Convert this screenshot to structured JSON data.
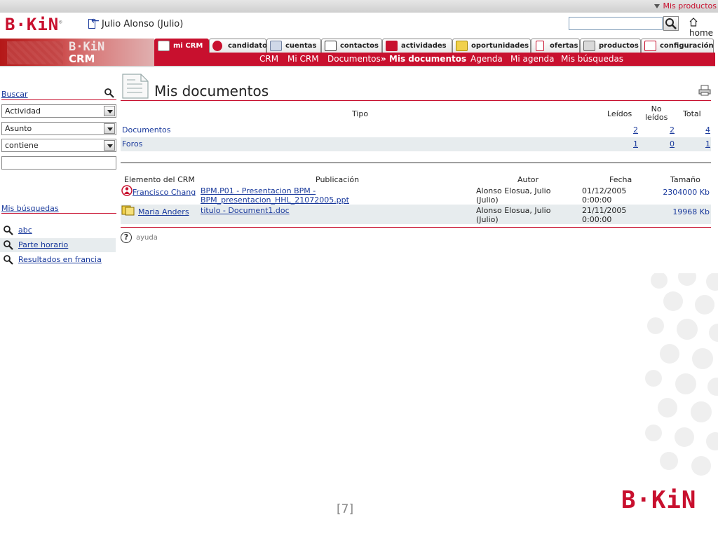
{
  "top": {
    "mis_productos": "Mis productos"
  },
  "header": {
    "logo": "B·KiN",
    "user": "Julio Alonso (Julio)",
    "search_placeholder": "",
    "home": "home"
  },
  "banner": {
    "brand": "B·KiN",
    "product": "CRM"
  },
  "tabs": [
    {
      "label": "mi CRM",
      "active": true,
      "icon": "monitor-icon"
    },
    {
      "label": "candidatos",
      "active": false,
      "icon": "person-icon"
    },
    {
      "label": "cuentas",
      "active": false,
      "icon": "folder-icon"
    },
    {
      "label": "contactos",
      "active": false,
      "icon": "contact-card-icon"
    },
    {
      "label": "actividades",
      "active": false,
      "icon": "calendar-icon"
    },
    {
      "label": "oportunidades",
      "active": false,
      "icon": "cards-icon"
    },
    {
      "label": "ofertas",
      "active": false,
      "icon": "alert-icon"
    },
    {
      "label": "productos",
      "active": false,
      "icon": "box-icon"
    },
    {
      "label": "configuración",
      "active": false,
      "icon": "wrench-icon"
    }
  ],
  "subnav": [
    {
      "label": "CRM",
      "current": false
    },
    {
      "label": "Mi CRM",
      "current": false
    },
    {
      "label": "Documentos",
      "current": false
    },
    {
      "label": "» Mis documentos",
      "current": true
    },
    {
      "label": "Agenda",
      "current": false
    },
    {
      "label": "Mi agenda",
      "current": false
    },
    {
      "label": "Mis búsquedas",
      "current": false
    }
  ],
  "left": {
    "buscar": "Buscar",
    "selects": [
      "Actividad",
      "Asunto",
      "contiene"
    ],
    "text_value": "",
    "mis_busquedas": "Mis búsquedas",
    "searches": [
      "abc",
      "Parte horario",
      "Resultados en francia"
    ]
  },
  "main": {
    "title": "Mis documentos",
    "summary": {
      "headers": {
        "tipo": "Tipo",
        "leidos": "Leídos",
        "no_leidos_1": "No",
        "no_leidos_2": "leídos",
        "total": "Total"
      },
      "rows": [
        {
          "tipo": "Documentos",
          "leidos": "2",
          "no_leidos": "2",
          "total": "4"
        },
        {
          "tipo": "Foros",
          "leidos": "1",
          "no_leidos": "0",
          "total": "1"
        }
      ]
    },
    "docs": {
      "headers": {
        "elemento": "Elemento del CRM",
        "publicacion": "Publicación",
        "autor": "Autor",
        "fecha": "Fecha",
        "tamano": "Tamaño"
      },
      "rows": [
        {
          "elemento": "Francisco Chang",
          "icon": "person-icon",
          "publicacion": "BPM.P01 - Presentacion BPM - BPM_presentacion_HHL_21072005.ppt",
          "autor": "Alonso Elosua, Julio (Julio)",
          "fecha_1": "01/12/2005",
          "fecha_2": "0:00:00",
          "tamano": "2304000 Kb"
        },
        {
          "elemento": "Maria Anders",
          "icon": "cards-icon",
          "publicacion": "titulo - Document1.doc",
          "autor": "Alonso Elosua, Julio (Julio)",
          "fecha_1": "21/11/2005",
          "fecha_2": "0:00:00",
          "tamano": "19968 Kb"
        }
      ]
    },
    "help": "ayuda"
  },
  "footer": {
    "slide_number": "[7]",
    "logo": "B·KiN"
  },
  "colors": {
    "brand_red": "#c8102e",
    "link_blue": "#1a3a9c",
    "row_alt": "#e7ecee"
  }
}
